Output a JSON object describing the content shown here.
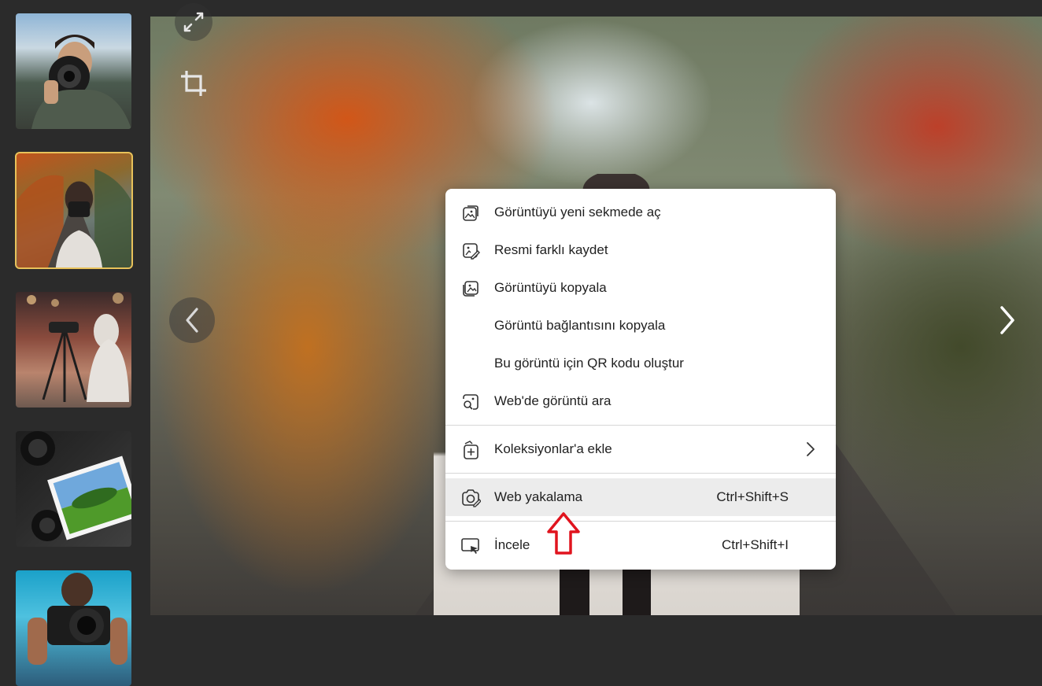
{
  "thumbnails": [
    {
      "alt": "Photographer with camera and jacket",
      "selected": false
    },
    {
      "alt": "Woman with camera on autumn road",
      "selected": true
    },
    {
      "alt": "Woman with camera on tripod",
      "selected": false
    },
    {
      "alt": "Cameras and photograph on table",
      "selected": false
    },
    {
      "alt": "Man holding camera on blue background",
      "selected": false
    }
  ],
  "viewer": {
    "expand_icon": "expand-icon",
    "crop_icon": "crop-icon",
    "prev_icon": "chevron-left-icon",
    "next_icon": "chevron-right-icon"
  },
  "context_menu": {
    "items": [
      {
        "label": "Görüntüyü yeni sekmede aç",
        "icon": "open-image-new-tab-icon"
      },
      {
        "label": "Resmi farklı kaydet",
        "icon": "save-image-icon"
      },
      {
        "label": "Görüntüyü kopyala",
        "icon": "copy-image-icon"
      },
      {
        "label": "Görüntü bağlantısını kopyala",
        "icon": ""
      },
      {
        "label": "Bu görüntü için QR kodu oluştur",
        "icon": ""
      },
      {
        "label": "Web'de görüntü ara",
        "icon": "visual-search-icon"
      }
    ],
    "collections": {
      "label": "Koleksiyonlar'a ekle",
      "icon": "collections-add-icon"
    },
    "web_capture": {
      "label": "Web yakalama",
      "shortcut": "Ctrl+Shift+S",
      "icon": "web-capture-icon"
    },
    "inspect": {
      "label": "İncele",
      "shortcut": "Ctrl+Shift+I",
      "icon": "inspect-icon"
    }
  },
  "colors": {
    "background": "#2b2b2b",
    "selected_border": "#e8c25a",
    "menu_highlight": "#ececec",
    "annotation_arrow": "#e0141e"
  }
}
